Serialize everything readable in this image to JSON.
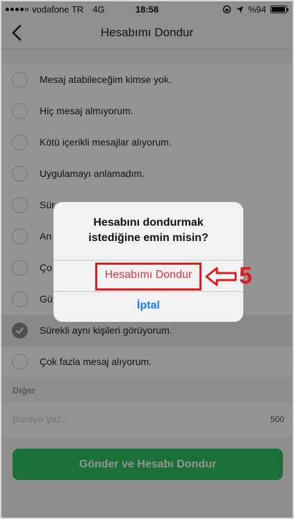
{
  "status_bar": {
    "carrier": "vodafone TR",
    "network": "4G",
    "time": "18:58",
    "battery": "%94",
    "battery_level": 0.94
  },
  "nav": {
    "title": "Hesabımı Dondur",
    "back_icon": "chevron-left-icon"
  },
  "reasons": [
    {
      "label": "Mesaj atabileceğim kimse yok.",
      "selected": false
    },
    {
      "label": "Hiç mesaj almıyorum.",
      "selected": false
    },
    {
      "label": "Kötü içerikli mesajlar alıyorum.",
      "selected": false
    },
    {
      "label": "Uygulamayı anlamadım.",
      "selected": false
    },
    {
      "label": "Sür",
      "selected": false
    },
    {
      "label": "An",
      "selected": false
    },
    {
      "label": "Ço",
      "selected": false
    },
    {
      "label": "Gü",
      "selected": false
    },
    {
      "label": "Sürekli aynı kişileri görüyorum.",
      "selected": true
    },
    {
      "label": "Çok fazla mesaj alıyorum.",
      "selected": false
    }
  ],
  "other": {
    "section_label": "Diğer",
    "placeholder": "Buraya yaz...",
    "counter": "500"
  },
  "submit_label": "Gönder ve Hesabı Dondur",
  "alert": {
    "title": "Hesabını dondurmak istediğine emin misin?",
    "confirm_label": "Hesabımı Dondur",
    "cancel_label": "İptal"
  },
  "annotation": {
    "step": "5"
  },
  "colors": {
    "accent_green": "#2fbf60",
    "destructive_red": "#e1323e",
    "ios_blue": "#1a7cf0",
    "annotation_red": "#e11a1a"
  }
}
